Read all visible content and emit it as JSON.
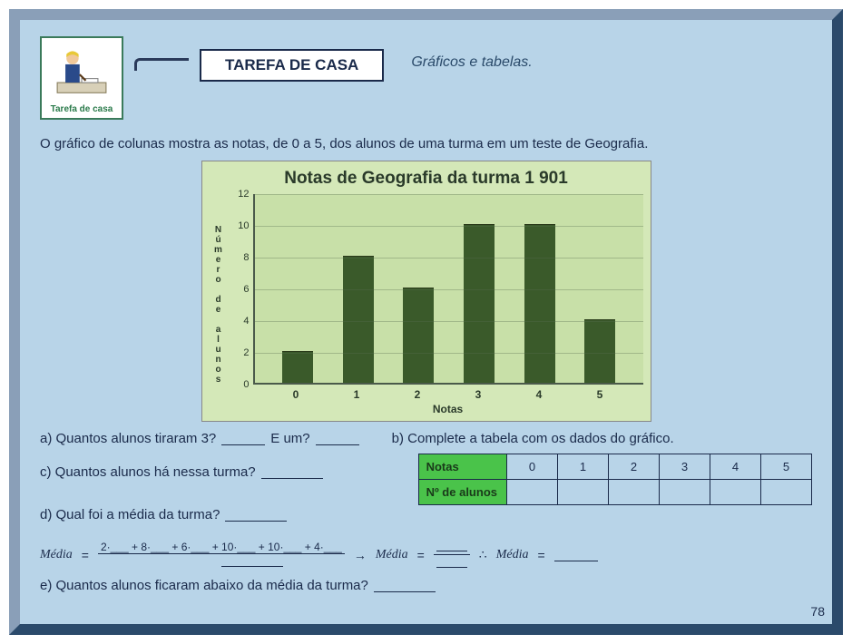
{
  "header": {
    "badge_caption": "Tarefa de casa",
    "title": "TAREFA DE CASA",
    "subtitle": "Gráficos e tabelas."
  },
  "intro": "O gráfico de colunas mostra as notas, de 0 a 5, dos alunos de uma turma em um teste de Geografia.",
  "chart_data": {
    "type": "bar",
    "title": "Notas de Geografia da turma 1 901",
    "categories": [
      "0",
      "1",
      "2",
      "3",
      "4",
      "5"
    ],
    "values": [
      2,
      8,
      6,
      10,
      10,
      4
    ],
    "xlabel": "Notas",
    "ylabel": "Número de alunos",
    "ylim": [
      0,
      12
    ],
    "yticks": [
      0,
      2,
      4,
      6,
      8,
      10,
      12
    ]
  },
  "questions": {
    "a_pre": "a)  Quantos alunos tiraram 3?",
    "a_mid": "E um?",
    "b_text": "b) Complete a tabela com os dados do gráfico.",
    "c_text": "c) Quantos alunos há nessa turma?",
    "d_text": "d) Qual foi a média da turma?",
    "e_text": "e) Quantos alunos ficaram abaixo da média da turma?"
  },
  "table": {
    "row1_label": "Notas",
    "row2_label": "Nº de alunos",
    "cols": [
      "0",
      "1",
      "2",
      "3",
      "4",
      "5"
    ]
  },
  "formula": {
    "media_label": "Média",
    "eq": "=",
    "numerator": "2·___ + 8·___ + 6·___ + 10·___ + 10·___ + 4·___",
    "arrow": "→",
    "therefore": "∴"
  },
  "page_number": "78"
}
